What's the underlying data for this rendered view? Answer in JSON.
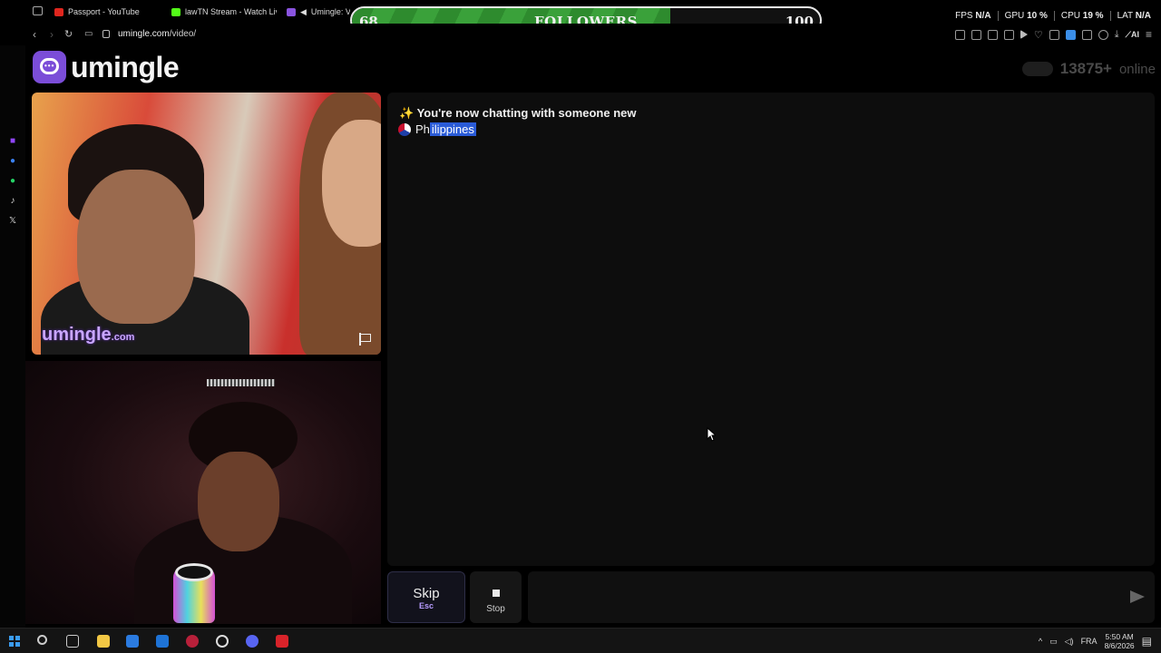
{
  "browser": {
    "tabs": [
      {
        "title": "Passport - YouTube",
        "favicon_color": "#e0261e"
      },
      {
        "title": "lawTN Stream - Watch Live",
        "favicon_color": "#53fc18"
      },
      {
        "title": "Umingle: Video Chat",
        "favicon_color": "#8a54e0"
      }
    ],
    "url_host": "umingle.com",
    "url_path": "/video/",
    "extension_ai_label": "AI"
  },
  "stats": {
    "fps_label": "FPS",
    "fps_value": "N/A",
    "gpu_label": "GPU",
    "gpu_value": "10 %",
    "cpu_label": "CPU",
    "cpu_value": "19 %",
    "lat_label": "LAT",
    "lat_value": "N/A"
  },
  "followers": {
    "label": "FOLLOWERS",
    "current": "68",
    "goal": "100",
    "progress": 0.68,
    "fill_color": "#3aa13a"
  },
  "site": {
    "logo_text": "umingle",
    "online_count": "13875+",
    "online_label": "online",
    "brand_color": "#7b4dd8"
  },
  "video": {
    "watermark_main": "umingle",
    "watermark_tld": ".com"
  },
  "chat": {
    "system_message_icon": "✨",
    "system_message": "You're now chatting with someone new",
    "country_prefix": "Ph",
    "country_selected": "ilippines"
  },
  "controls": {
    "skip_label": "Skip",
    "skip_shortcut": "Esc",
    "stop_label": "Stop",
    "message_value": ""
  },
  "taskbar": {
    "language": "FRA",
    "time": "5:50 AM",
    "date": "8/6/2026"
  }
}
